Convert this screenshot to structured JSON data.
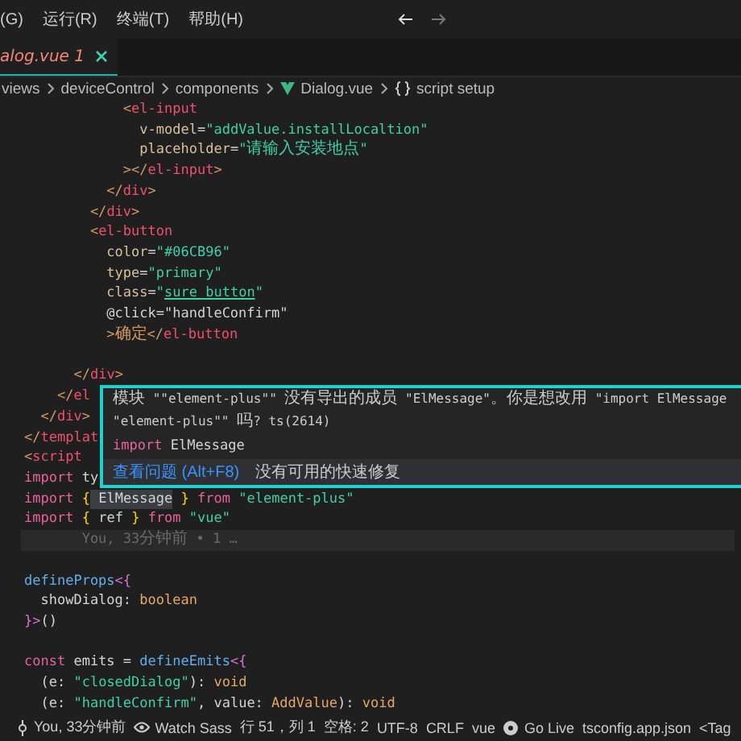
{
  "menu": [
    "(G)",
    "运行(R)",
    "终端(T)",
    "帮助(H)"
  ],
  "tab": {
    "label": "alog.vue",
    "problems": "1",
    "selected": true
  },
  "breadcrumb": [
    {
      "label": "views",
      "kind": "folder"
    },
    {
      "label": "deviceControl",
      "kind": "folder"
    },
    {
      "label": "components",
      "kind": "folder"
    },
    {
      "label": "Dialog.vue",
      "kind": "vue"
    },
    {
      "label": "script setup",
      "kind": "braces"
    }
  ],
  "code_lines": [
    {
      "kind": "code",
      "tokens": [
        {
          "text": "            <",
          "kind": "punct"
        },
        {
          "text": "el-input",
          "kind": "tag"
        }
      ]
    },
    {
      "kind": "code",
      "tokens": [
        {
          "text": "              v-model",
          "kind": "attr"
        },
        {
          "text": "=",
          "kind": "plain"
        },
        {
          "text": "\"addValue.installLocaltion\"",
          "kind": "string"
        }
      ]
    },
    {
      "kind": "code",
      "tokens": [
        {
          "text": "              placeholder",
          "kind": "attr"
        },
        {
          "text": "=",
          "kind": "plain"
        },
        {
          "text": "\"请输入安装地点\"",
          "kind": "string"
        }
      ]
    },
    {
      "kind": "code",
      "tokens": [
        {
          "text": "            ></",
          "kind": "punct"
        },
        {
          "text": "el-input",
          "kind": "tag"
        },
        {
          "text": ">",
          "kind": "punct"
        }
      ]
    },
    {
      "kind": "code",
      "tokens": [
        {
          "text": "          </",
          "kind": "punct"
        },
        {
          "text": "div",
          "kind": "tag"
        },
        {
          "text": ">",
          "kind": "punct"
        }
      ]
    },
    {
      "kind": "code",
      "tokens": [
        {
          "text": "        </",
          "kind": "punct"
        },
        {
          "text": "div",
          "kind": "tag"
        },
        {
          "text": ">",
          "kind": "punct"
        }
      ]
    },
    {
      "kind": "code",
      "tokens": [
        {
          "text": "        <",
          "kind": "punct"
        },
        {
          "text": "el-button",
          "kind": "tag"
        }
      ]
    },
    {
      "kind": "code",
      "tokens": [
        {
          "text": "          color",
          "kind": "attr"
        },
        {
          "text": "=",
          "kind": "plain"
        },
        {
          "text": "\"#06CB96\"",
          "kind": "string"
        }
      ]
    },
    {
      "kind": "code",
      "tokens": [
        {
          "text": "          type",
          "kind": "attr"
        },
        {
          "text": "=",
          "kind": "plain"
        },
        {
          "text": "\"primary\"",
          "kind": "string"
        }
      ]
    },
    {
      "kind": "code",
      "tokens": [
        {
          "text": "          class",
          "kind": "attr"
        },
        {
          "text": "=",
          "kind": "plain"
        },
        {
          "text": "\"",
          "kind": "string"
        },
        {
          "text": "sure_button",
          "kind": "link"
        },
        {
          "text": "\"",
          "kind": "string"
        }
      ]
    },
    {
      "kind": "code",
      "tokens": [
        {
          "text": "          @click=\"handleConfirm\"",
          "kind": "plain"
        }
      ]
    },
    {
      "kind": "code",
      "tokens": [
        {
          "text": "          >确定</",
          "kind": "punct"
        },
        {
          "text": "el-button",
          "kind": "tag"
        }
      ]
    },
    {
      "kind": "blank"
    },
    {
      "kind": "code",
      "tokens": [
        {
          "text": "      </",
          "kind": "punct"
        },
        {
          "text": "div",
          "kind": "tag"
        },
        {
          "text": ">",
          "kind": "punct"
        }
      ]
    },
    {
      "kind": "code",
      "tokens": [
        {
          "text": "    </",
          "kind": "punct"
        },
        {
          "text": "el",
          "kind": "tag"
        }
      ]
    },
    {
      "kind": "code",
      "tokens": [
        {
          "text": "  </",
          "kind": "punct"
        },
        {
          "text": "div",
          "kind": "tag"
        },
        {
          "text": ">",
          "kind": "punct"
        }
      ]
    },
    {
      "kind": "code",
      "tokens": [
        {
          "text": "</",
          "kind": "punct"
        },
        {
          "text": "templat",
          "kind": "tag"
        }
      ]
    },
    {
      "kind": "code",
      "tokens": [
        {
          "text": "<",
          "kind": "punct"
        },
        {
          "text": "script",
          "kind": "tag"
        }
      ]
    },
    {
      "kind": "code",
      "tokens": [
        {
          "text": "import",
          "kind": "keyword"
        },
        {
          "text": " ty",
          "kind": "plain"
        }
      ]
    },
    {
      "kind": "code",
      "tokens": [
        {
          "text": "import",
          "kind": "keyword"
        },
        {
          "text": " {",
          "kind": "brace"
        },
        {
          "text": " ElMessage",
          "kind": "error"
        },
        {
          "text": " }",
          "kind": "brace"
        },
        {
          "text": " from",
          "kind": "keyword"
        },
        {
          "text": " \"element-plus\"",
          "kind": "string"
        }
      ]
    },
    {
      "kind": "code",
      "tokens": [
        {
          "text": "import",
          "kind": "keyword"
        },
        {
          "text": " {",
          "kind": "brace"
        },
        {
          "text": " ref",
          "kind": "plain"
        },
        {
          "text": " }",
          "kind": "brace"
        },
        {
          "text": " from",
          "kind": "keyword"
        },
        {
          "text": " \"vue\"",
          "kind": "string"
        }
      ]
    },
    {
      "kind": "blame",
      "tokens": [
        {
          "text": "       You, 33分钟前 • 1 …",
          "kind": "comment"
        }
      ]
    },
    {
      "kind": "blank"
    },
    {
      "kind": "code",
      "tokens": [
        {
          "text": "defineProps",
          "kind": "function"
        },
        {
          "text": "<{",
          "kind": "bracket"
        }
      ]
    },
    {
      "kind": "code",
      "tokens": [
        {
          "text": "  showDialog: ",
          "kind": "plain"
        },
        {
          "text": "boolean",
          "kind": "type"
        }
      ]
    },
    {
      "kind": "code",
      "tokens": [
        {
          "text": "}>",
          "kind": "bracket"
        },
        {
          "text": "()",
          "kind": "plain"
        }
      ]
    },
    {
      "kind": "blank"
    },
    {
      "kind": "code",
      "tokens": [
        {
          "text": "const",
          "kind": "keyword"
        },
        {
          "text": " emits = ",
          "kind": "plain"
        },
        {
          "text": "defineEmits",
          "kind": "function"
        },
        {
          "text": "<{",
          "kind": "bracket"
        }
      ]
    },
    {
      "kind": "code",
      "tokens": [
        {
          "text": "  (e: ",
          "kind": "plain"
        },
        {
          "text": "\"closedDialog\"",
          "kind": "string"
        },
        {
          "text": "): ",
          "kind": "plain"
        },
        {
          "text": "void",
          "kind": "type"
        }
      ]
    },
    {
      "kind": "code",
      "tokens": [
        {
          "text": "  (e: ",
          "kind": "plain"
        },
        {
          "text": "\"handleConfirm\"",
          "kind": "string"
        },
        {
          "text": ", value: ",
          "kind": "plain"
        },
        {
          "text": "AddValue",
          "kind": "type"
        },
        {
          "text": "): ",
          "kind": "plain"
        },
        {
          "text": "void",
          "kind": "type"
        }
      ]
    }
  ],
  "hover": {
    "message_lines": [
      "模块 \"\"element-plus\"\" 没有导出的成员 \"ElMessage\"。你是想改用 \"import ElMessage",
      "\"element-plus\"\" 吗? ts(2614)"
    ],
    "snippet": [
      {
        "text": "import",
        "kind": "keyword"
      },
      {
        "text": " ElMessage",
        "kind": "plain"
      }
    ],
    "action_link": "查看问题 (Alt+F8)",
    "action_note": "没有可用的快速修复"
  },
  "status_bar": [
    {
      "label": "You, 33分钟前",
      "kind": "commit"
    },
    {
      "label": "Watch Sass",
      "kind": "eye"
    },
    {
      "label": "行 51，列 1",
      "kind": "text"
    },
    {
      "label": "空格: 2",
      "kind": "text"
    },
    {
      "label": "UTF-8",
      "kind": "text"
    },
    {
      "label": "CRLF",
      "kind": "text"
    },
    {
      "label": "vue",
      "kind": "text"
    },
    {
      "label": "Go Live",
      "kind": "live"
    },
    {
      "label": "tsconfig.app.json",
      "kind": "text"
    },
    {
      "label": "<Tag",
      "kind": "text"
    }
  ]
}
